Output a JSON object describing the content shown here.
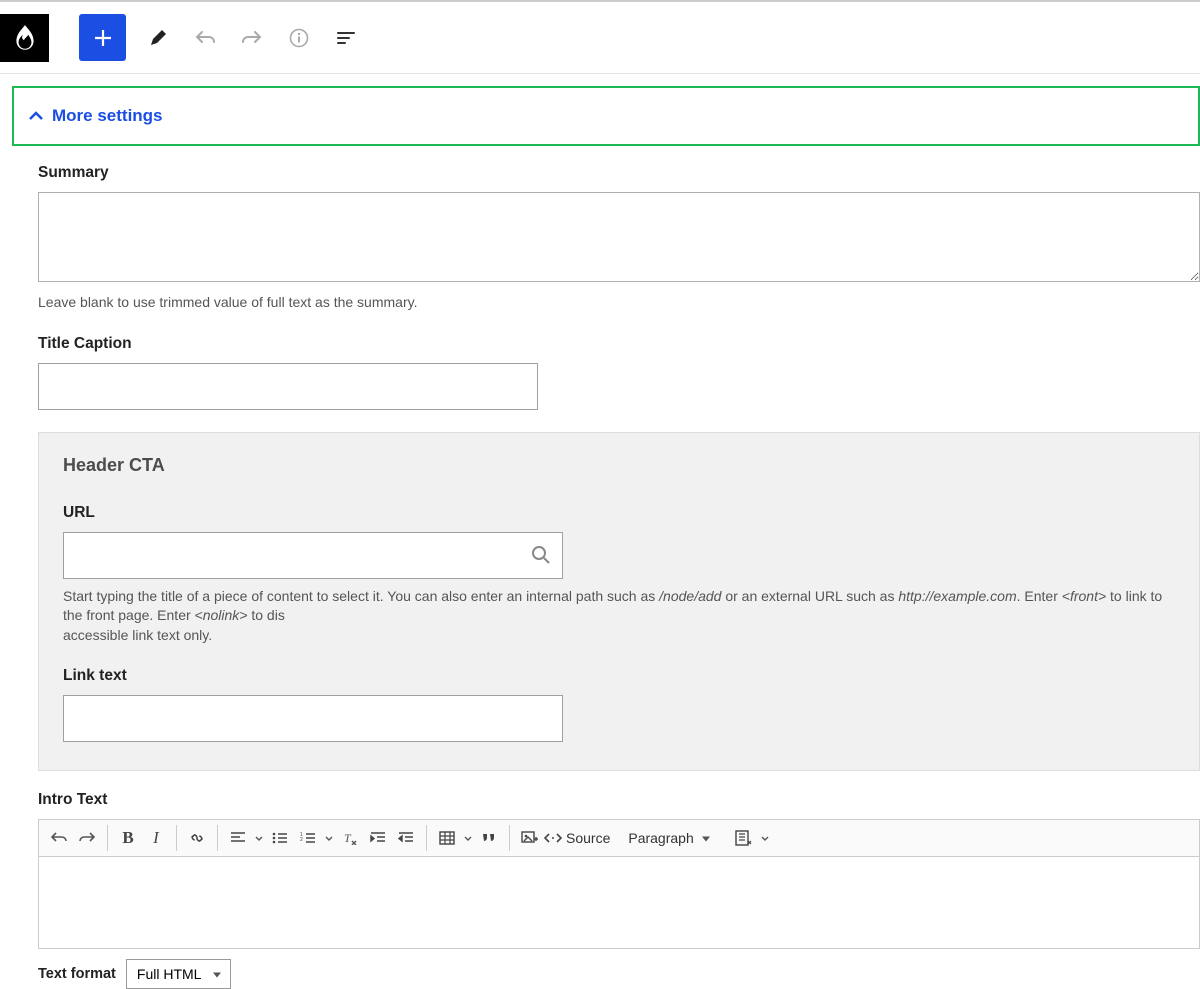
{
  "more_settings_label": "More settings",
  "summary": {
    "label": "Summary",
    "help": "Leave blank to use trimmed value of full text as the summary."
  },
  "title_caption": {
    "label": "Title Caption"
  },
  "header_cta": {
    "title": "Header CTA",
    "url": {
      "label": "URL",
      "help_1": "Start typing the title of a piece of content to select it. You can also enter an internal path such as ",
      "help_em1": "/node/add",
      "help_2": " or an external URL such as ",
      "help_em2": "http://example.com",
      "help_3": ". Enter ",
      "help_em3": "<front>",
      "help_4": " to link to the front page. Enter ",
      "help_em4": "<nolink>",
      "help_5": " to dis",
      "help_6": "accessible link text only."
    },
    "link_text": {
      "label": "Link text"
    }
  },
  "intro_text": {
    "label": "Intro Text",
    "source_label": "Source",
    "paragraph_option": "Paragraph"
  },
  "text_format": {
    "label": "Text format",
    "option": "Full HTML"
  }
}
